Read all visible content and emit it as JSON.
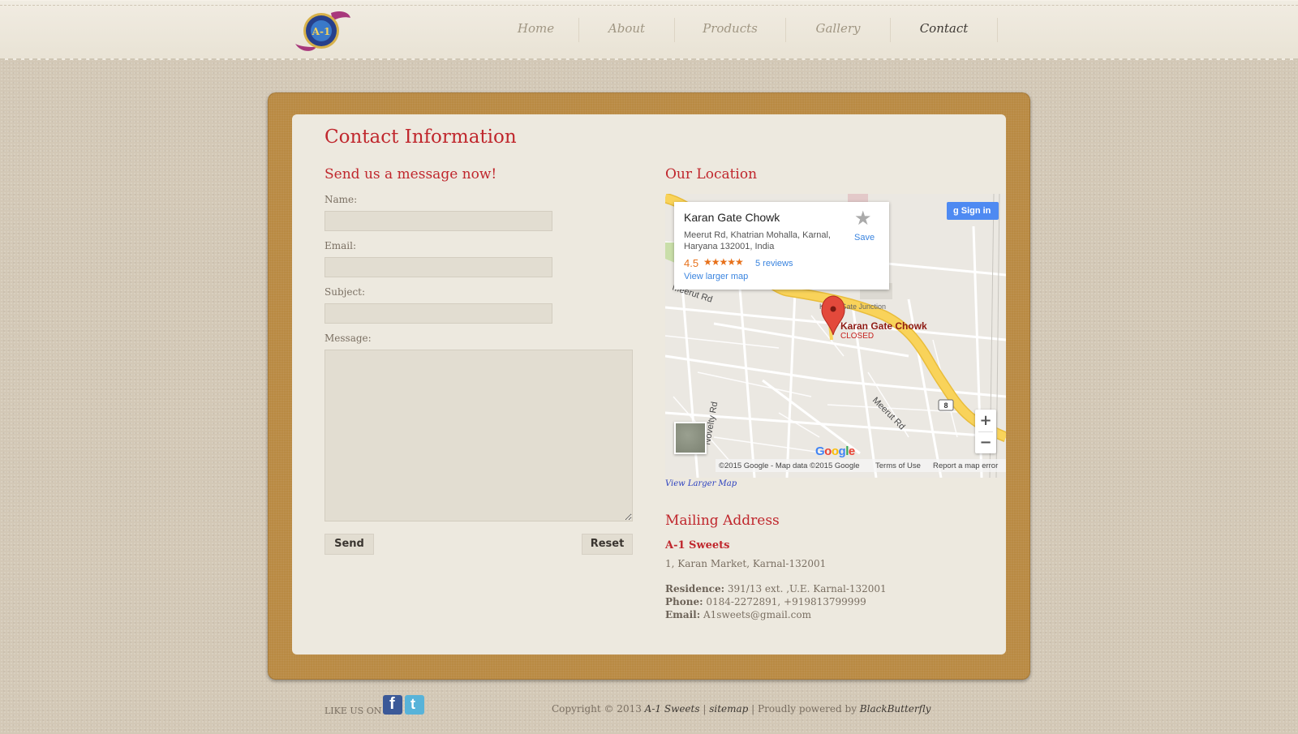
{
  "nav": {
    "items": [
      {
        "label": "Home",
        "active": false
      },
      {
        "label": "About",
        "active": false
      },
      {
        "label": "Products",
        "active": false
      },
      {
        "label": "Gallery",
        "active": false
      },
      {
        "label": "Contact",
        "active": true
      }
    ]
  },
  "logo": {
    "text": "A-1"
  },
  "page_title": "Contact Information",
  "form": {
    "heading": "Send us a message now!",
    "name_label": "Name:",
    "name_value": "",
    "email_label": "Email:",
    "email_value": "",
    "subject_label": "Subject:",
    "subject_value": "",
    "message_label": "Message:",
    "message_value": "",
    "send_label": "Send",
    "reset_label": "Reset"
  },
  "location": {
    "heading": "Our Location",
    "view_larger_map": "View Larger Map",
    "map": {
      "place_name": "Karan Gate Chowk",
      "address": "Meerut Rd, Khatrian Mohalla, Karnal, Haryana 132001, India",
      "rating": "4.5",
      "stars": "★★★★★",
      "reviews": "5 reviews",
      "view_larger": "View larger map",
      "save": "Save",
      "sign_in": "Sign in",
      "marker_title": "Karan Gate Chowk",
      "marker_status": "CLOSED",
      "road_labels": [
        "Meerut Rd",
        "Meerut Rd",
        "Novelty Rd",
        "Karan Gate Junction"
      ],
      "highway_shield": "8",
      "attribution": "©2015 Google - Map data ©2015 Google",
      "terms": "Terms of Use",
      "report": "Report a map error",
      "google": "Google",
      "zoom_in": "+",
      "zoom_out": "−",
      "colors": {
        "main_road": "#f9d35a",
        "marker": "#e3493b",
        "background": "#ebe8e2"
      }
    }
  },
  "mailing": {
    "heading": "Mailing Address",
    "company": "A-1 Sweets",
    "address": "1, Karan Market, Karnal-132001",
    "residence_label": "Residence:",
    "residence": "391/13 ext. ,U.E. Karnal-132001",
    "phone_label": "Phone:",
    "phone": "0184-2272891, +919813799999",
    "email_label": "Email:",
    "email": "A1sweets@gmail.com"
  },
  "footer": {
    "like_us": "LIKE US ON",
    "copyright": "Copyright © 2013",
    "company": "A-1 Sweets",
    "sep1": " | ",
    "sitemap": "sitemap",
    "sep2": " | Proudly powered by ",
    "powered_by": "BlackButterfly"
  },
  "colors": {
    "accent": "#c0272d",
    "board": "#b98a43",
    "panel": "#ede9df",
    "page_bg": "#d3c8b6"
  }
}
